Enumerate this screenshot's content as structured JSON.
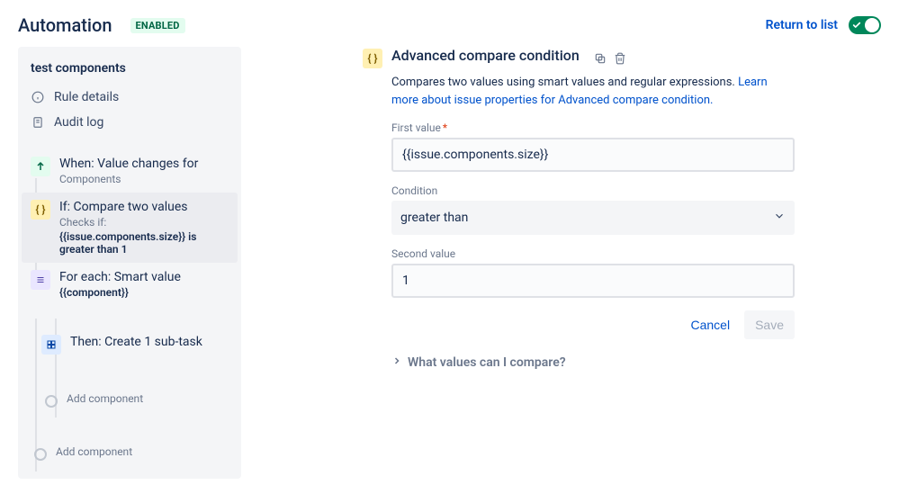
{
  "header": {
    "title": "Automation",
    "badge": "ENABLED",
    "return_link": "Return to list"
  },
  "sidebar": {
    "title": "test components",
    "nav": {
      "rule_details": "Rule details",
      "audit_log": "Audit log"
    },
    "rules": {
      "trigger": {
        "label": "When: Value changes for",
        "sub": "Components"
      },
      "condition": {
        "label": "If: Compare two values",
        "sub_prefix": "Checks if:",
        "sub_detail": "{{issue.components.size}} is greater than 1"
      },
      "branch": {
        "label": "For each: Smart value",
        "detail": "{{component}}"
      },
      "action": {
        "label": "Then: Create 1 sub-task"
      },
      "add_inner": "Add component",
      "add_outer": "Add component"
    }
  },
  "main": {
    "title": "Advanced compare condition",
    "description": "Compares two values using smart values and regular expressions. ",
    "learn_link": "Learn more about issue properties for Advanced compare condition.",
    "fields": {
      "first_value_label": "First value",
      "first_value": "{{issue.components.size}}",
      "condition_label": "Condition",
      "condition_value": "greater than",
      "second_value_label": "Second value",
      "second_value": "1"
    },
    "actions": {
      "cancel": "Cancel",
      "save": "Save"
    },
    "expander": "What values can I compare?"
  }
}
